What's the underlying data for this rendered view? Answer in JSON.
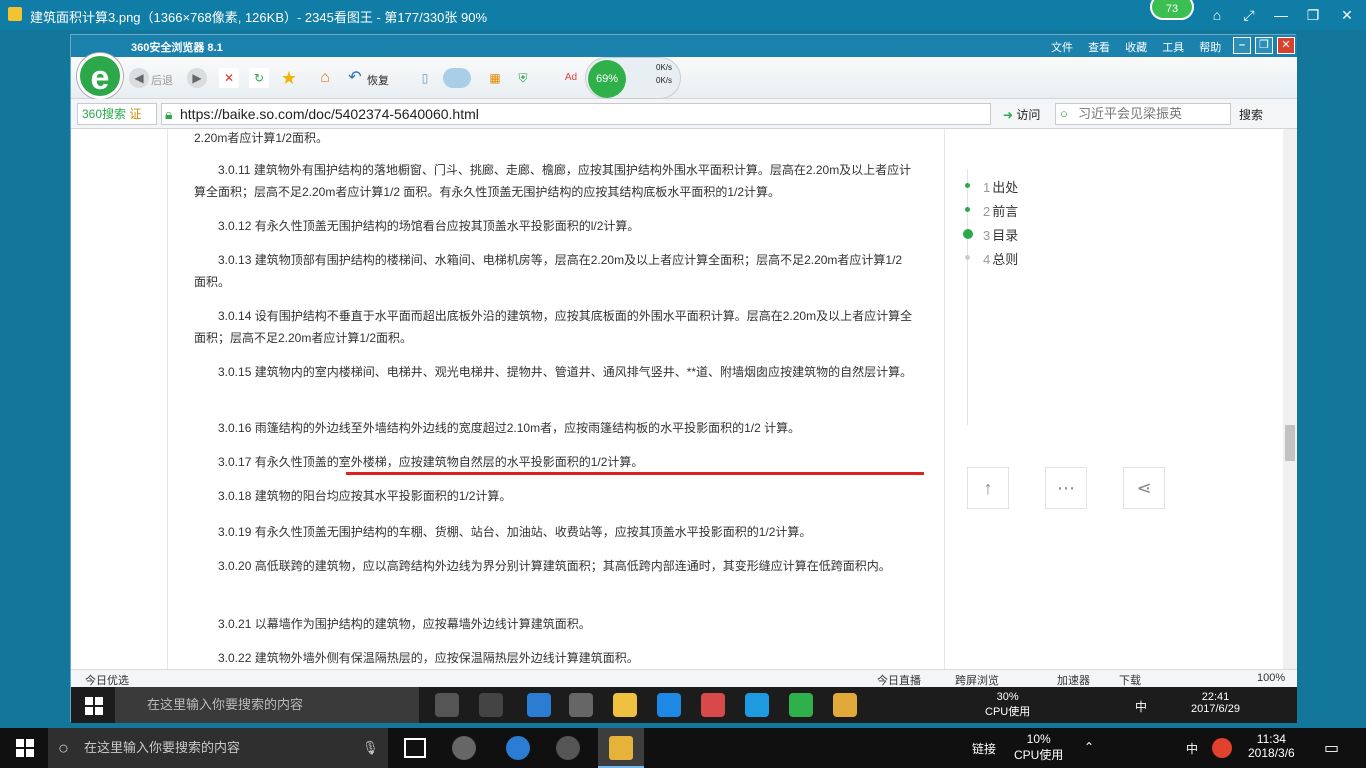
{
  "viewer": {
    "title": "建筑面积计算3.png（1366×768像素, 126KB）- 2345看图王 - 第177/330张 90%",
    "badge": "73"
  },
  "browser": {
    "title": "360安全浏览器 8.1",
    "menu": [
      "文件",
      "查看",
      "收藏",
      "工具",
      "帮助"
    ],
    "toolbar": {
      "back": "后退",
      "restore": "恢复"
    },
    "speed": {
      "percent": "69%",
      "up": "0K/s",
      "down": "0K/s"
    },
    "search_engine": "360搜索",
    "cert": "证",
    "url": "https://baike.so.com/doc/5402374-5640060.html",
    "visit": "访问",
    "search_placeholder": "习近平会见梁振英",
    "search_button": "搜索"
  },
  "article": {
    "top_fragment": "2.20m者应计算1/2面积。",
    "paragraphs": [
      {
        "code": "3.0.11",
        "text": "建筑物外有围护结构的落地橱窗、门斗、挑廊、走廊、檐廊，应按其围护结构外围水平面积计算。层高在2.20m及以上者应计算全面积；层高不足2.20m者应计算1/2 面积。有永久性顶盖无围护结构的应按其结构底板水平面积的1/2计算。"
      },
      {
        "code": "3.0.12",
        "text": "有永久性顶盖无围护结构的场馆看台应按其顶盖水平投影面积的l/2计算。"
      },
      {
        "code": "3.0.13",
        "text": "建筑物顶部有围护结构的楼梯间、水箱间、电梯机房等，层高在2.20m及以上者应计算全面积；层高不足2.20m者应计算1/2面积。"
      },
      {
        "code": "3.0.14",
        "text": "设有围护结构不垂直于水平面而超出底板外沿的建筑物，应按其底板面的外围水平面积计算。层高在2.20m及以上者应计算全面积；层高不足2.20m者应计算1/2面积。"
      },
      {
        "code": "3.0.15",
        "text": "建筑物内的室内楼梯间、电梯井、观光电梯井、提物井、管道井、通风排气竖井、**道、附墙烟囱应按建筑物的自然层计算。"
      },
      {
        "code": "3.0.16",
        "text": "雨篷结构的外边线至外墙结构外边线的宽度超过2.10m者，应按雨篷结构板的水平投影面积的1/2 计算。"
      },
      {
        "code": "3.0.17",
        "text": "有永久性顶盖的室外楼梯，应按建筑物自然层的水平投影面积的1/2计算。"
      },
      {
        "code": "3.0.18",
        "text": "建筑物的阳台均应按其水平投影面积的1/2计算。"
      },
      {
        "code": "3.0.19",
        "text": "有永久性顶盖无围护结构的车棚、货棚、站台、加油站、收费站等，应按其顶盖水平投影面积的1/2计算。"
      },
      {
        "code": "3.0.20",
        "text": "高低联跨的建筑物，应以高跨结构外边线为界分别计算建筑面积；其高低跨内部连通时，其变形缝应计算在低跨面积内。"
      },
      {
        "code": "3.0.21",
        "text": "以幕墙作为围护结构的建筑物，应按幕墙外边线计算建筑面积。"
      },
      {
        "code": "3.0.22",
        "text": "建筑物外墙外侧有保温隔热层的，应按保温隔热层外边线计算建筑面积。"
      }
    ]
  },
  "toc": [
    {
      "num": "1",
      "label": "出处"
    },
    {
      "num": "2",
      "label": "前言"
    },
    {
      "num": "3",
      "label": "目录"
    },
    {
      "num": "4",
      "label": "总则"
    }
  ],
  "statusbar": {
    "left": "今日优选",
    "live": "今日直播",
    "cast": "跨屏浏览",
    "accelerator": "加速器",
    "download": "下载",
    "zoom": "100%"
  },
  "inner_taskbar": {
    "search_placeholder": "在这里输入你要搜索的内容",
    "cpu_percent": "30%",
    "cpu_label": "CPU使用",
    "ime": "中",
    "time": "22:41",
    "date": "2017/6/29"
  },
  "taskbar": {
    "search_placeholder": "在这里输入你要搜索的内容",
    "link": "链接",
    "cpu_percent": "10%",
    "cpu_label": "CPU使用",
    "ime": "中",
    "time": "11:34",
    "date": "2018/3/6"
  }
}
